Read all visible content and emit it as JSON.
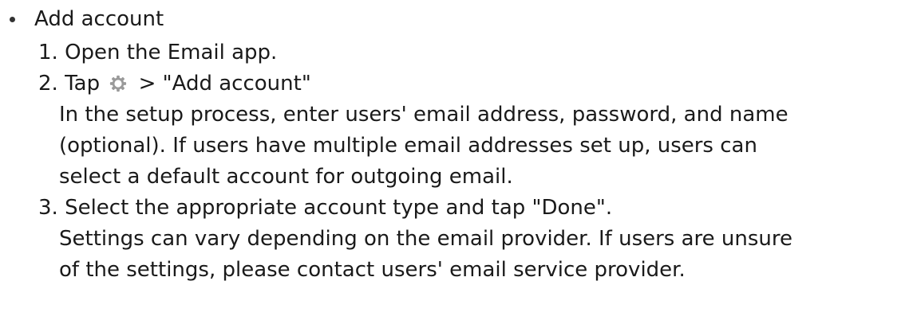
{
  "section": {
    "title": "Add account"
  },
  "steps": [
    {
      "number": "1.",
      "text": "Open the Email app."
    },
    {
      "number": "2.",
      "text_before_icon": "Tap",
      "icon": "settings-gear-icon",
      "text_after_icon": "> \"Add account\"",
      "description_lines": [
        "In the setup process, enter users' email address, password, and name",
        "(optional). If users have multiple email addresses set up, users can",
        "select a default account for outgoing email."
      ]
    },
    {
      "number": "3.",
      "text": "Select the appropriate account type and tap \"Done\".",
      "description_lines": [
        "Settings can vary depending on the email provider. If users are unsure",
        "of the settings, please contact users' email service provider."
      ]
    }
  ],
  "colors": {
    "text": "#1a1a1a",
    "icon": "#9a9a9a"
  }
}
